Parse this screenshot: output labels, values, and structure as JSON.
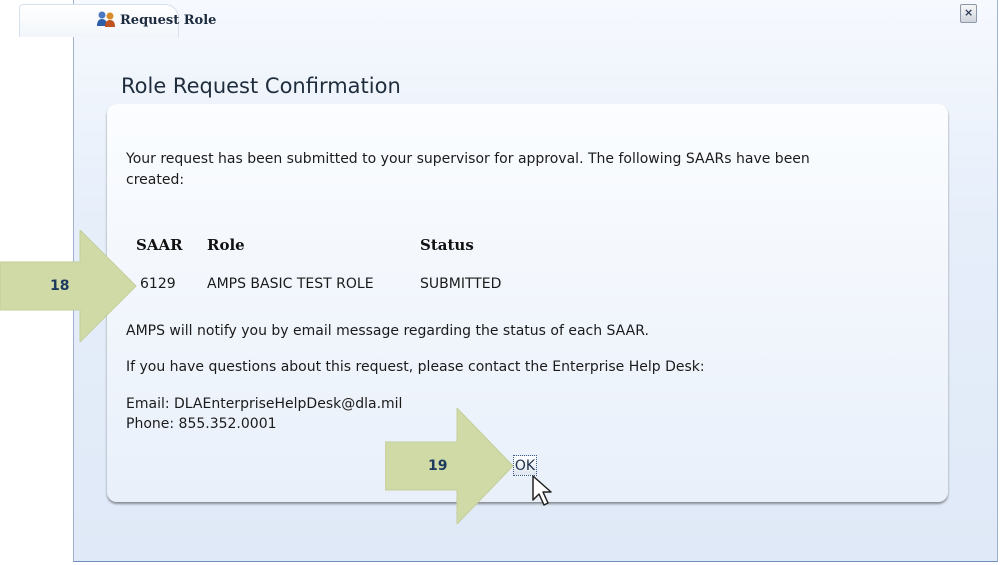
{
  "window": {
    "tab_title": "Request Role",
    "close_glyph": "×"
  },
  "dialog": {
    "heading": "Role Request Confirmation",
    "intro_line1": "Your request has been submitted to your supervisor for approval. The following SAARs have been",
    "intro_line2": "created:",
    "table": {
      "headers": [
        "SAAR",
        "Role",
        "Status"
      ],
      "rows": [
        {
          "saar": "6129",
          "role": "AMPS BASIC TEST ROLE",
          "status": "SUBMITTED"
        }
      ]
    },
    "notify": "AMPS will notify you by email message regarding the status of each SAAR.",
    "questions": "If you have questions about this request, please contact the Enterprise Help Desk:",
    "email": "Email: DLAEnterpriseHelpDesk@dla.mil",
    "phone": "Phone: 855.352.0001",
    "ok_label": "OK"
  },
  "callouts": {
    "first": "18",
    "second": "19"
  },
  "colors": {
    "arrow": "#cfdaa7",
    "window_bg": "#e6eefa",
    "panel_border": "#7a7a7a"
  },
  "icons": {
    "tab": "role-people-icon",
    "close": "close-icon",
    "cursor": "mouse-pointer-icon"
  }
}
